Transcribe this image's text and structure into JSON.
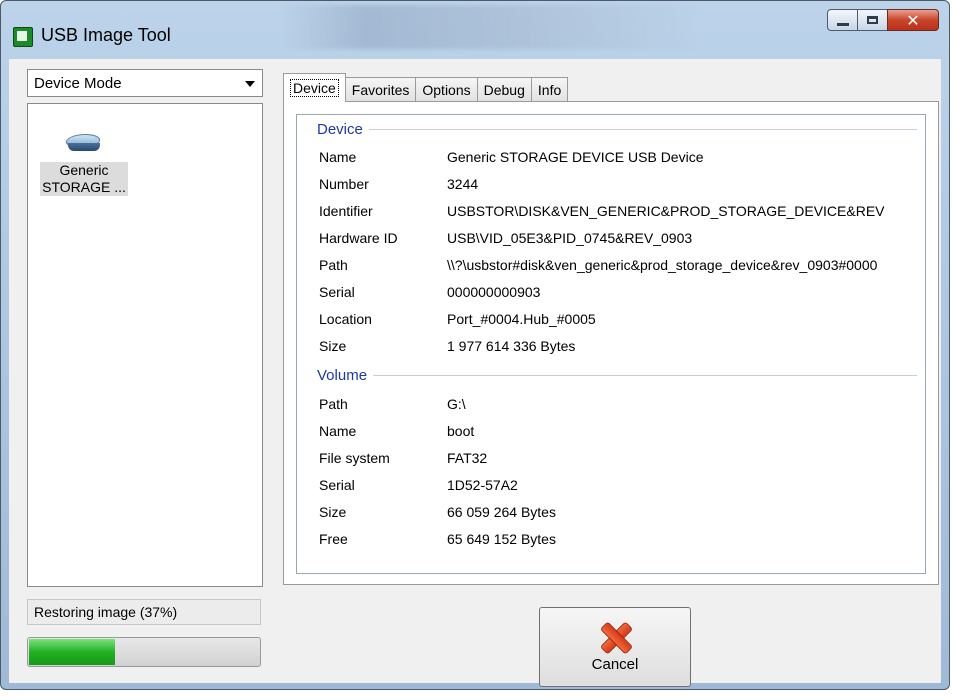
{
  "window": {
    "title": "USB Image Tool"
  },
  "left": {
    "mode": "Device Mode",
    "devices": [
      {
        "label_line1": "Generic",
        "label_line2": "STORAGE ..."
      }
    ],
    "status": "Restoring image (37%)",
    "progress_fraction": 0.37
  },
  "tabs": [
    "Device",
    "Favorites",
    "Options",
    "Debug",
    "Info"
  ],
  "device_group": {
    "title": "Device",
    "rows": [
      {
        "key": "Name",
        "value": "Generic STORAGE DEVICE USB Device"
      },
      {
        "key": "Number",
        "value": "3244"
      },
      {
        "key": "Identifier",
        "value": "USBSTOR\\DISK&VEN_GENERIC&PROD_STORAGE_DEVICE&REV"
      },
      {
        "key": "Hardware ID",
        "value": "USB\\VID_05E3&PID_0745&REV_0903"
      },
      {
        "key": "Path",
        "value": "\\\\?\\usbstor#disk&ven_generic&prod_storage_device&rev_0903#0000"
      },
      {
        "key": "Serial",
        "value": "000000000903"
      },
      {
        "key": "Location",
        "value": "Port_#0004.Hub_#0005"
      },
      {
        "key": "Size",
        "value": "1 977 614 336 Bytes"
      }
    ]
  },
  "volume_group": {
    "title": "Volume",
    "rows": [
      {
        "key": "Path",
        "value": "G:\\"
      },
      {
        "key": "Name",
        "value": "boot"
      },
      {
        "key": "File system",
        "value": "FAT32"
      },
      {
        "key": "Serial",
        "value": "1D52-57A2"
      },
      {
        "key": "Size",
        "value": "66 059 264 Bytes"
      },
      {
        "key": "Free",
        "value": "65 649 152 Bytes"
      }
    ]
  },
  "cancel_label": "Cancel"
}
